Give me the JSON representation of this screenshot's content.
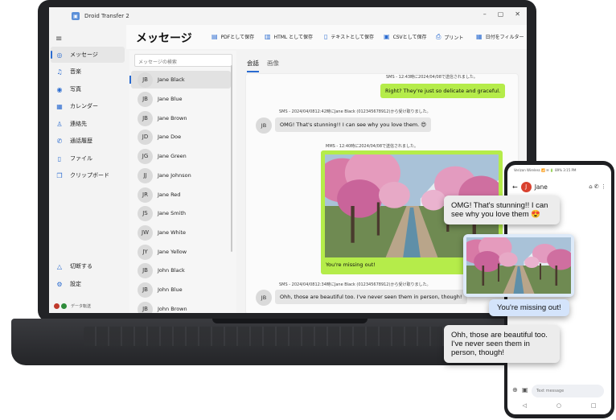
{
  "app": {
    "title": "Droid Transfer 2",
    "window_controls": [
      "–",
      "▢",
      "✕"
    ]
  },
  "nav": {
    "items": [
      {
        "label": "メッセージ",
        "icon": "message-icon"
      },
      {
        "label": "音楽",
        "icon": "music-icon"
      },
      {
        "label": "写真",
        "icon": "photo-icon"
      },
      {
        "label": "カレンダー",
        "icon": "calendar-icon"
      },
      {
        "label": "連絡先",
        "icon": "contacts-icon"
      },
      {
        "label": "通話履歴",
        "icon": "phone-icon"
      },
      {
        "label": "ファイル",
        "icon": "file-icon"
      },
      {
        "label": "クリップボード",
        "icon": "clipboard-icon"
      }
    ],
    "bottom": [
      {
        "label": "切断する",
        "icon": "disconnect-icon"
      },
      {
        "label": "設定",
        "icon": "settings-icon"
      }
    ],
    "status": "データ転送"
  },
  "header": {
    "title": "メッセージ",
    "actions": [
      "PDFとして保存",
      "HTML として保存",
      "テキストとして保存",
      "CSVとして保存",
      "プリント",
      "日付をフィルター"
    ]
  },
  "list": {
    "search_placeholder": "メッセージの検索",
    "contacts": [
      {
        "initials": "JB",
        "name": "Jane Black"
      },
      {
        "initials": "JB",
        "name": "Jane Blue"
      },
      {
        "initials": "JB",
        "name": "Jane Brown"
      },
      {
        "initials": "JD",
        "name": "Jane Doe"
      },
      {
        "initials": "JG",
        "name": "Jane Green"
      },
      {
        "initials": "JJ",
        "name": "Jane Johnson"
      },
      {
        "initials": "JR",
        "name": "Jane Red"
      },
      {
        "initials": "JS",
        "name": "Jane Smith"
      },
      {
        "initials": "JW",
        "name": "Jane White"
      },
      {
        "initials": "JY",
        "name": "Jane Yellow"
      },
      {
        "initials": "JB",
        "name": "John Black"
      },
      {
        "initials": "JB",
        "name": "John Blue"
      },
      {
        "initials": "JB",
        "name": "John Brown"
      }
    ]
  },
  "conversation": {
    "tabs": [
      "会話",
      "画像"
    ],
    "messages": [
      {
        "meta": "SMS - 12:43時に2024/04/08で送信されました。",
        "text": "Right? They're just so delicate and graceful."
      },
      {
        "meta": "SMS - 2024/04/0812:42時にJane Black (012345678912)から受け取りました。",
        "text": "OMG! That's stunning!! I can see why you love them. 😍",
        "initials": "JB"
      },
      {
        "meta": "MMS - 12:40時に2024/04/08で送信されました。",
        "text": "You're missing out!"
      },
      {
        "meta": "SMS - 2024/04/0812:34時にJane Black (012345678912)から受け取りました。",
        "text": "Ohh, those are beautiful too. I've never seen them in person, though!",
        "initials": "JB"
      }
    ]
  },
  "phone": {
    "status": "Verizon Wireless 📶  ✉ 🔋 89% 3:15 PM",
    "contact": "Jane",
    "initial": "J",
    "input_placeholder": "Text message"
  },
  "floating": {
    "bubble1": "OMG! That's stunning!! I can see why you love them 😍",
    "bubble2": "You're missing out!",
    "bubble3": "Ohh, those are beautiful too. I've never seen them in person, though!"
  },
  "colors": {
    "accent": "#2a6bd0",
    "sent_bubble": "#b5ec4a",
    "received_bubble": "#e5e5e5",
    "phone_avatar": "#d9412f"
  }
}
